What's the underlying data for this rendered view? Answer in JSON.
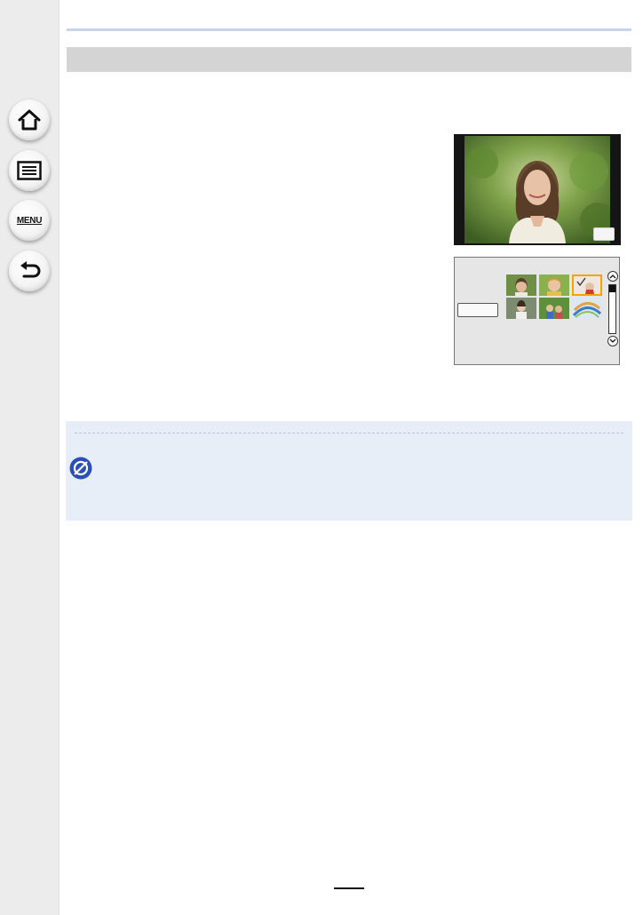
{
  "sidebar": {
    "buttons": [
      {
        "id": "home",
        "icon": "home-icon"
      },
      {
        "id": "contents",
        "icon": "list-icon"
      },
      {
        "id": "menu",
        "icon": "menu-icon",
        "label": "MENU"
      },
      {
        "id": "back",
        "icon": "back-arrow-icon"
      }
    ]
  },
  "section": {
    "title": ""
  },
  "figures": {
    "playback_photo": {
      "description_icon": "portrait-photo"
    },
    "grid_selection": {
      "selected_index": 2,
      "thumbnails": 6
    }
  },
  "note": {
    "icon": "not-available-icon"
  },
  "footer": {
    "page_number": ""
  },
  "colors": {
    "sidebar_bg": "#ececec",
    "accent_rule": "#c9d3ec",
    "section_bar": "#d4d4d4",
    "note_bg": "#e8eef8",
    "note_icon": "#2a50b4",
    "selection": "#f2a400"
  }
}
